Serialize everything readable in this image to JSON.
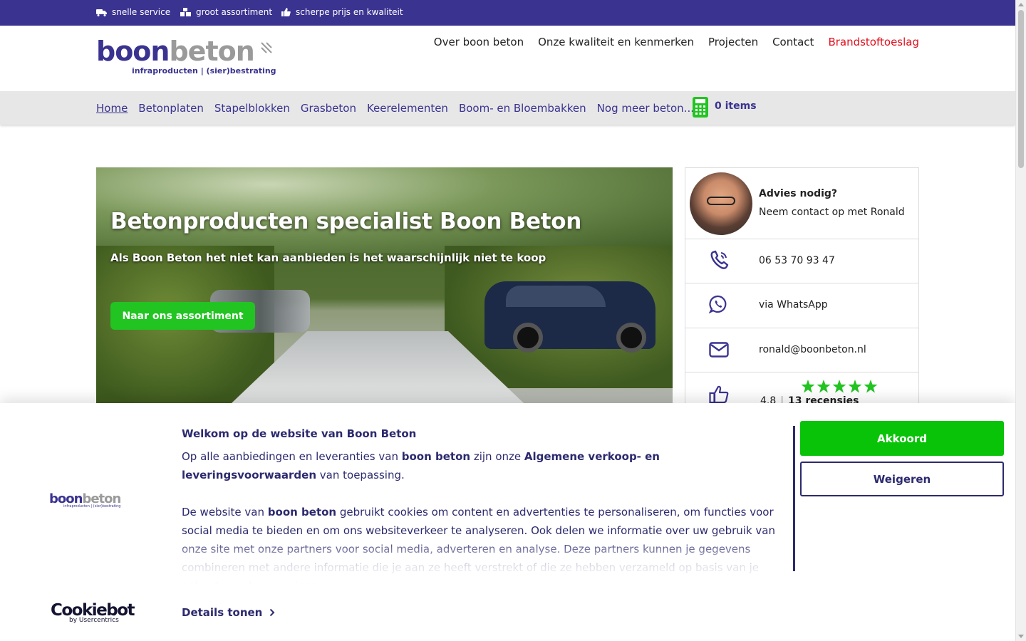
{
  "topbar": {
    "usps": [
      "snelle service",
      "groot assortiment",
      "scherpe prijs en kwaliteit"
    ],
    "bg_color": "#3a3390"
  },
  "logo": {
    "word_part1": "boon",
    "word_part2": "beton",
    "tagline": "infraproducten | (sier)bestrating"
  },
  "topnav": [
    "Over boon beton",
    "Onze kwaliteit en kenmerken",
    "Projecten",
    "Contact",
    "Brandstoftoeslag"
  ],
  "catnav": {
    "items": [
      "Home",
      "Betonplaten",
      "Stapelblokken",
      "Grasbeton",
      "Keerelementen",
      "Boom- en Bloembakken",
      "Nog meer beton..."
    ],
    "more_arrow": "↓",
    "cart_label": "0 items"
  },
  "hero": {
    "title": "Betonproducten specialist Boon Beton",
    "subtitle": "Als Boon Beton het niet kan aanbieden is het waarschijnlijk niet te koop",
    "cta": "Naar ons assortiment"
  },
  "contact": {
    "heading": "Advies nodig?",
    "subheading": "Neem contact op met Ronald",
    "phone": "06 53 70 93 47",
    "whatsapp": "via WhatsApp",
    "email": "ronald@boonbeton.nl",
    "rating_score": "4.8",
    "rating_separator": "|",
    "reviews": "13 recensies",
    "stars": 5,
    "star_color": "#22c422"
  },
  "cookie": {
    "title": "Welkom op de website van Boon Beton",
    "p1_a": "Op alle aanbiedingen en leveranties van ",
    "p1_b": "boon beton",
    "p1_c": " zijn onze ",
    "p1_d": "Algemene verkoop- en leveringsvoorwaarden",
    "p1_e": " van toepassing.",
    "p2_a": "De website van ",
    "p2_b": "boon beton",
    "p2_c": " gebruikt cookies om content en advertenties te personaliseren, om functies voor social media te bieden en om ons websiteverkeer te analyseren. Ook delen we informatie over uw gebruik van onze site met onze partners voor social media, adverteren en analyse. Deze partners kunnen je gegevens combineren met andere informatie die je aan ze heeft verstrekt of die ze hebben verzameld op basis van je gebruik van hun services.",
    "accept": "Akkoord",
    "decline": "Weigeren",
    "details": "Details tonen",
    "logo_word1": "boon",
    "logo_word2": "beton",
    "logo_tagline": "infraproducten | (sier)bestrating",
    "cookiebot_name": "Cookiebot",
    "cookiebot_by": "by Usercentrics",
    "accept_color": "#08c308"
  }
}
